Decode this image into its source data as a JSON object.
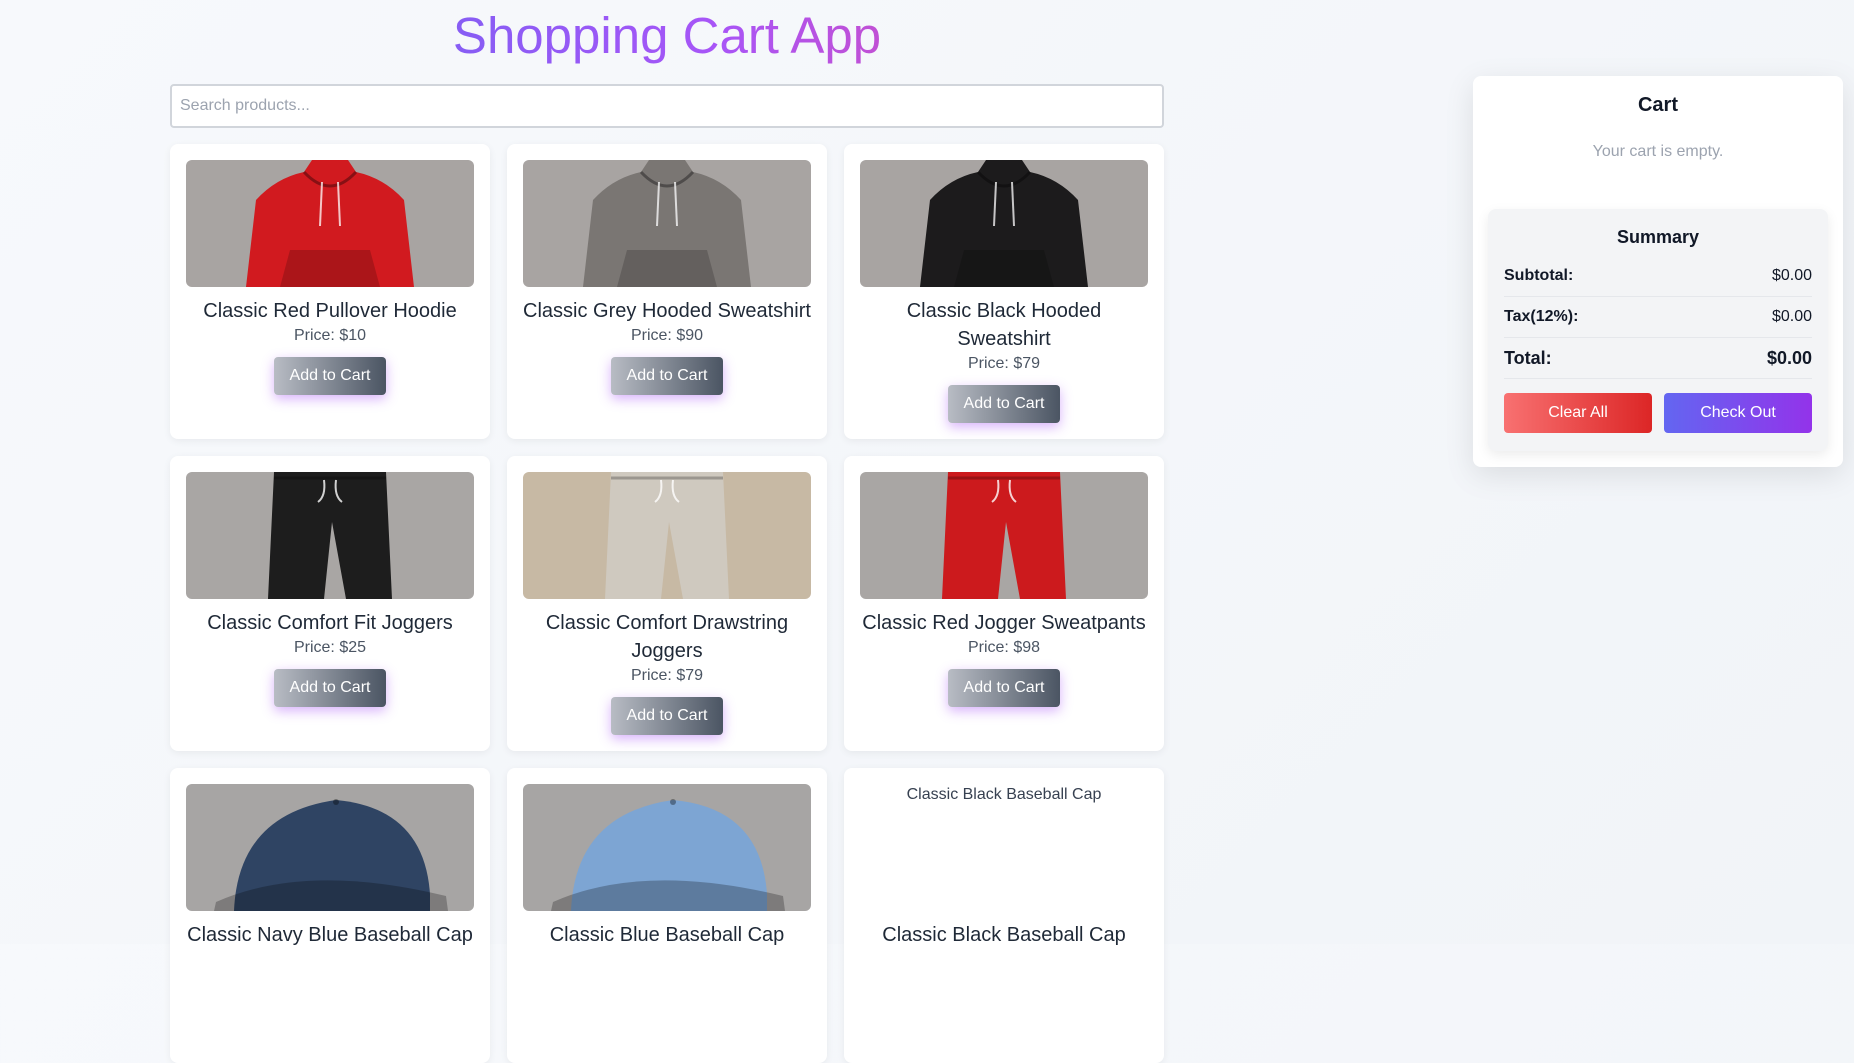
{
  "header": {
    "title": "Shopping Cart App"
  },
  "search": {
    "placeholder": "Search products..."
  },
  "products": [
    {
      "name": "Classic Red Pullover Hoodie",
      "price": "Price: $10",
      "button": "Add to Cart",
      "image": "hoodie",
      "color": "#d11a1f"
    },
    {
      "name": "Classic Grey Hooded Sweatshirt",
      "price": "Price: $90",
      "button": "Add to Cart",
      "image": "hoodie",
      "color": "#7a7673"
    },
    {
      "name": "Classic Black Hooded Sweatshirt",
      "price": "Price: $79",
      "button": "Add to Cart",
      "image": "hoodie",
      "color": "#1c1b1c"
    },
    {
      "name": "Classic Comfort Fit Joggers",
      "price": "Price: $25",
      "button": "Add to Cart",
      "image": "joggers",
      "color": "#1d1d1d"
    },
    {
      "name": "Classic Comfort Drawstring Joggers",
      "price": "Price: $79",
      "button": "Add to Cart",
      "image": "joggers",
      "color": "#cfc9bf"
    },
    {
      "name": "Classic Red Jogger Sweatpants",
      "price": "Price: $98",
      "button": "Add to Cart",
      "image": "joggers",
      "color": "#cc1a1d"
    },
    {
      "name": "Classic Navy Blue Baseball Cap",
      "price": "",
      "button": "",
      "image": "cap",
      "color": "#2f4463"
    },
    {
      "name": "Classic Blue Baseball Cap",
      "price": "",
      "button": "",
      "image": "cap",
      "color": "#7da5d3"
    },
    {
      "name": "Classic Black Baseball Cap",
      "price": "",
      "button": "",
      "image": "broken",
      "alt": "Classic Black Baseball Cap",
      "color": "#ffffff"
    }
  ],
  "cart": {
    "title": "Cart",
    "empty_message": "Your cart is empty.",
    "summary": {
      "title": "Summary",
      "subtotal_label": "Subtotal:",
      "subtotal_value": "$0.00",
      "tax_label": "Tax(12%):",
      "tax_value": "$0.00",
      "total_label": "Total:",
      "total_value": "$0.00",
      "clear_label": "Clear All",
      "checkout_label": "Check Out"
    }
  }
}
